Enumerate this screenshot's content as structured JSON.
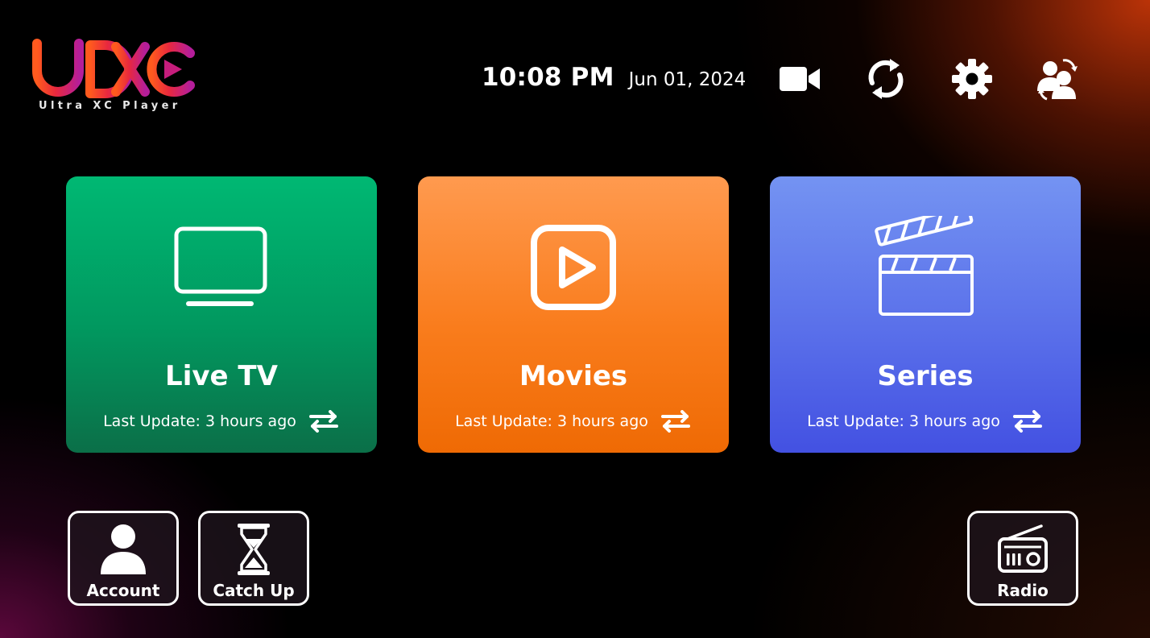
{
  "app": {
    "logo_text": "UXC",
    "logo_subtitle": "Ultra XC Player"
  },
  "header": {
    "time": "10:08 PM",
    "date": "Jun 01, 2024",
    "buttons": [
      {
        "name": "record",
        "icon": "video-camera-icon"
      },
      {
        "name": "refresh",
        "icon": "refresh-icon"
      },
      {
        "name": "settings",
        "icon": "gear-icon"
      },
      {
        "name": "switch-user",
        "icon": "switch-user-icon"
      }
    ]
  },
  "cards": [
    {
      "title": "Live TV",
      "update": "Last Update: 3 hours ago",
      "icon": "tv-icon",
      "color": "#01985f"
    },
    {
      "title": "Movies",
      "update": "Last Update: 3 hours ago",
      "icon": "play-icon",
      "color": "#f97c1c"
    },
    {
      "title": "Series",
      "update": "Last Update: 3 hours ago",
      "icon": "clapperboard-icon",
      "color": "#5a70ea"
    }
  ],
  "tiles": [
    {
      "label": "Account",
      "icon": "user-icon"
    },
    {
      "label": "Catch Up",
      "icon": "hourglass-icon"
    },
    {
      "label": "Radio",
      "icon": "radio-icon"
    }
  ],
  "colors": {
    "background": "#000000",
    "accent_orange": "#c0360a",
    "accent_purple": "#5f083e",
    "logo_gradient": [
      "#ff5a1e",
      "#b51e9a"
    ]
  }
}
